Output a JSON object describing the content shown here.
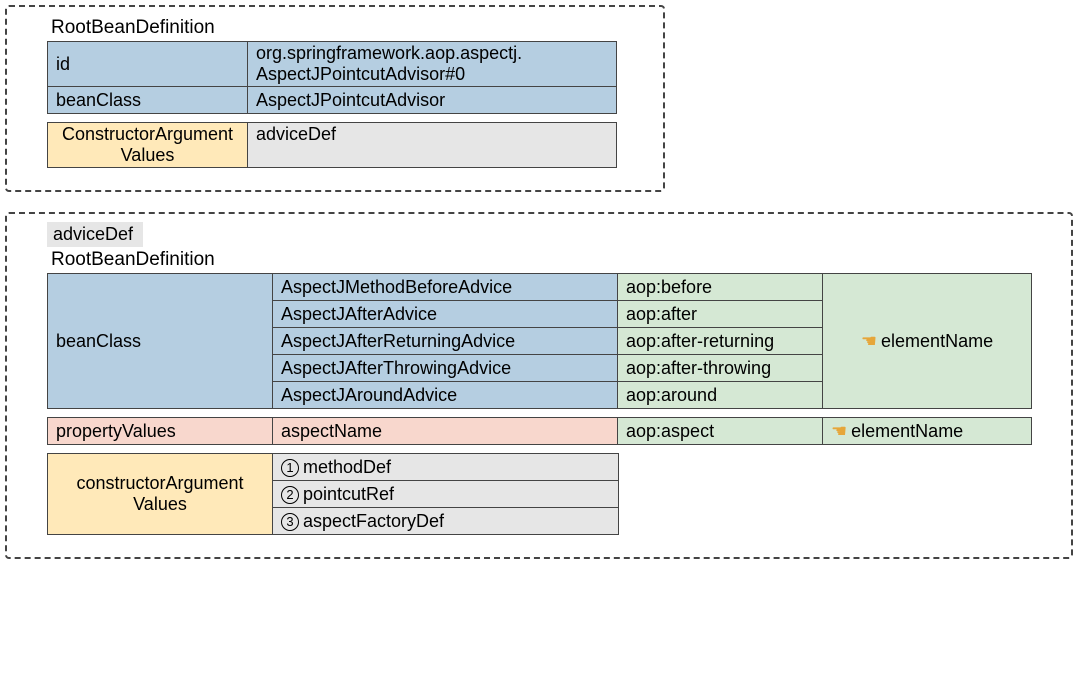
{
  "box1": {
    "title": "RootBeanDefinition",
    "rows": [
      {
        "key": "id",
        "val": "org.springframework.aop.aspectj.\nAspectJPointcutAdvisor#0"
      },
      {
        "key": "beanClass",
        "val": "AspectJPointcutAdvisor"
      }
    ],
    "constructor": {
      "label": "ConstructorArgument\nValues",
      "val": "adviceDef"
    }
  },
  "box2": {
    "tag": "adviceDef",
    "title": "RootBeanDefinition",
    "beanClass": {
      "label": "beanClass",
      "rows": [
        {
          "cls": "AspectJMethodBeforeAdvice",
          "aop": "aop:before"
        },
        {
          "cls": "AspectJAfterAdvice",
          "aop": "aop:after"
        },
        {
          "cls": "AspectJAfterReturningAdvice",
          "aop": "aop:after-returning"
        },
        {
          "cls": "AspectJAfterThrowingAdvice",
          "aop": "aop:after-throwing"
        },
        {
          "cls": "AspectJAroundAdvice",
          "aop": "aop:around"
        }
      ],
      "elementName": "elementName"
    },
    "propertyValues": {
      "label": "propertyValues",
      "name": "aspectName",
      "aop": "aop:aspect",
      "elementName": "elementName"
    },
    "constructor": {
      "label": "constructorArgument\nValues",
      "items": [
        "methodDef",
        "pointcutRef",
        "aspectFactoryDef"
      ],
      "nums": [
        "1",
        "2",
        "3"
      ]
    }
  }
}
